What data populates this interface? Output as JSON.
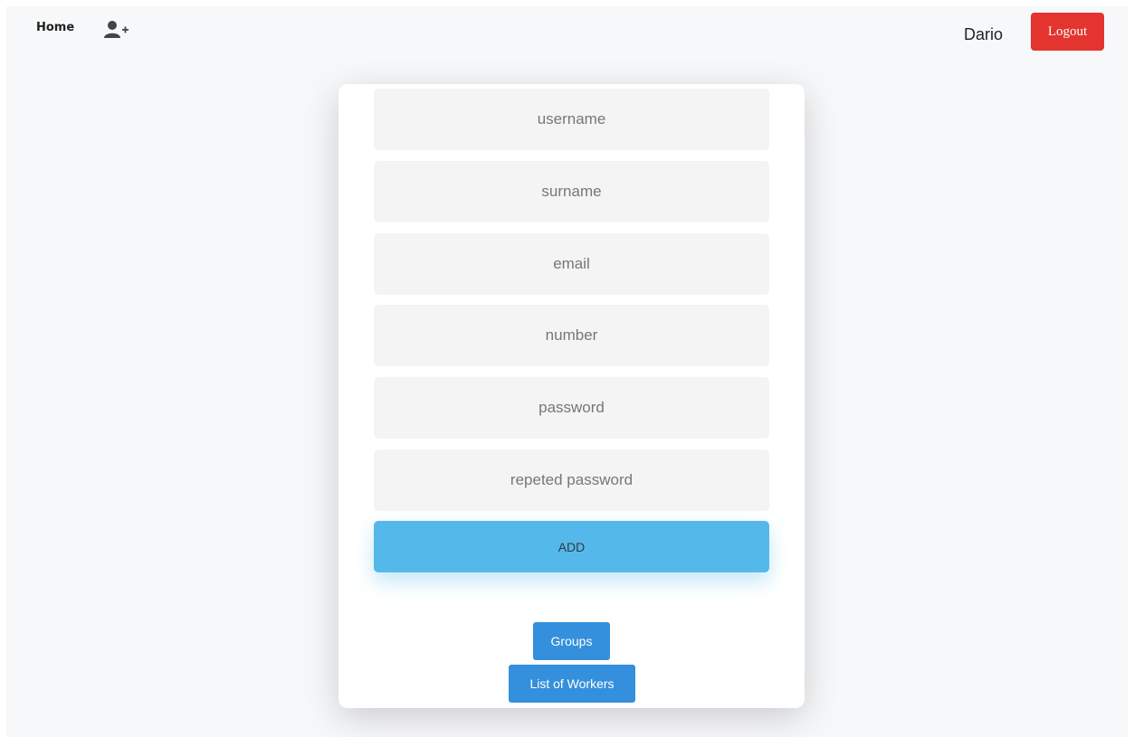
{
  "nav": {
    "home_label": "Home",
    "add_user_icon": "user-plus-icon",
    "current_user": "Dario",
    "logout_label": "Logout"
  },
  "form": {
    "username_placeholder": "username",
    "surname_placeholder": "surname",
    "email_placeholder": "email",
    "number_placeholder": "number",
    "password_placeholder": "password",
    "repeat_password_placeholder": "repeted password",
    "add_label": "ADD"
  },
  "links": {
    "groups_label": "Groups",
    "workers_label": "List of Workers"
  },
  "colors": {
    "logout": "#e3342f",
    "add_button": "#54b9ea",
    "primary": "#3490dc",
    "field_bg": "#f4f4f4",
    "page_bg": "#f7f8fa"
  }
}
